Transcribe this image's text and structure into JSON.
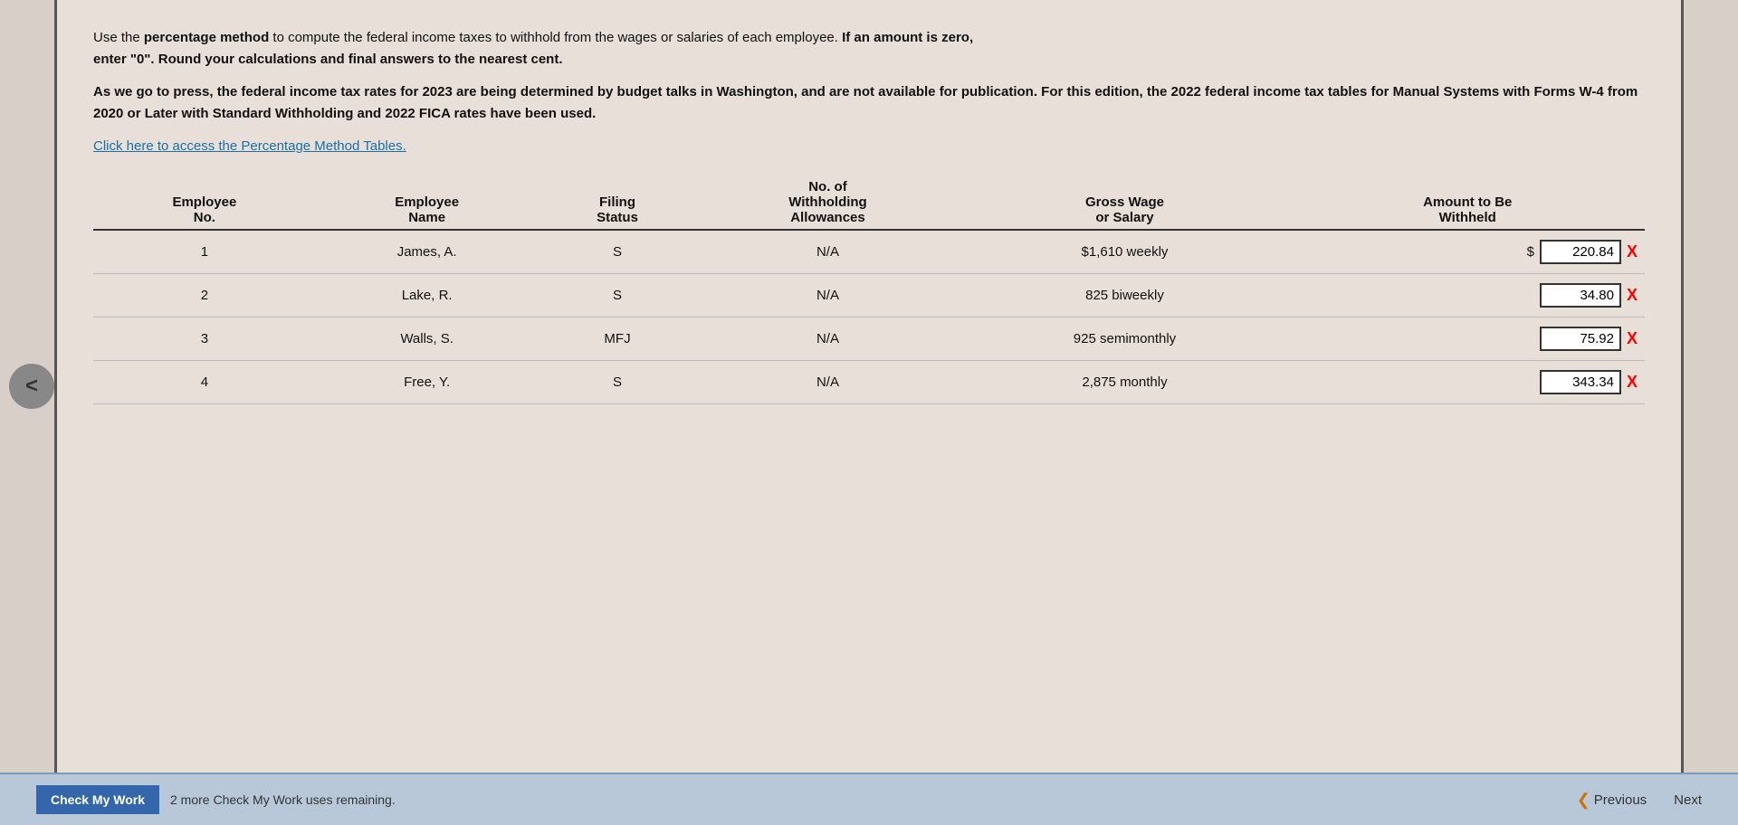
{
  "intro": {
    "line1": "Use the ",
    "line1_bold": "percentage method",
    "line1_rest": " to compute the federal income taxes to withhold from the wages or salaries of each employee. ",
    "line1_bold2": "If an amount is zero,",
    "line2_bold": "enter \"0\". Round your calculations and final answers to the nearest cent.",
    "para2_bold": "As we go to press, the federal income tax rates for 2023 are being determined by budget talks in Washington, and are not available for publication. For this edition, the 2022 federal income tax tables for Manual Systems with Forms W-4 from 2020 or Later with Standard Withholding and 2022 FICA rates have been used.",
    "link_text": "Click here to access the Percentage Method Tables."
  },
  "table": {
    "headers": {
      "col1_line1": "Employee",
      "col1_line2": "No.",
      "col2_line1": "Employee",
      "col2_line2": "Name",
      "col3_line1": "Filing",
      "col3_line2": "Status",
      "col4_line1": "No. of",
      "col4_line2": "Withholding",
      "col4_line3": "Allowances",
      "col5_line1": "Gross Wage",
      "col5_line2": "or Salary",
      "col6_line1": "Amount to Be",
      "col6_line2": "Withheld"
    },
    "rows": [
      {
        "no": "1",
        "name": "James, A.",
        "status": "S",
        "allowances": "N/A",
        "wage": "$1,610  weekly",
        "has_dollar": true,
        "amount": "220.84"
      },
      {
        "no": "2",
        "name": "Lake, R.",
        "status": "S",
        "allowances": "N/A",
        "wage": "825  biweekly",
        "has_dollar": false,
        "amount": "34.80"
      },
      {
        "no": "3",
        "name": "Walls, S.",
        "status": "MFJ",
        "allowances": "N/A",
        "wage": "925  semimonthly",
        "has_dollar": false,
        "amount": "75.92"
      },
      {
        "no": "4",
        "name": "Free, Y.",
        "status": "S",
        "allowances": "N/A",
        "wage": "2,875  monthly",
        "has_dollar": false,
        "amount": "343.34"
      }
    ]
  },
  "footer": {
    "check_work_label": "Check My Work",
    "remaining_text": "2 more Check My Work uses remaining.",
    "previous_label": "Previous",
    "next_label": "Next"
  }
}
